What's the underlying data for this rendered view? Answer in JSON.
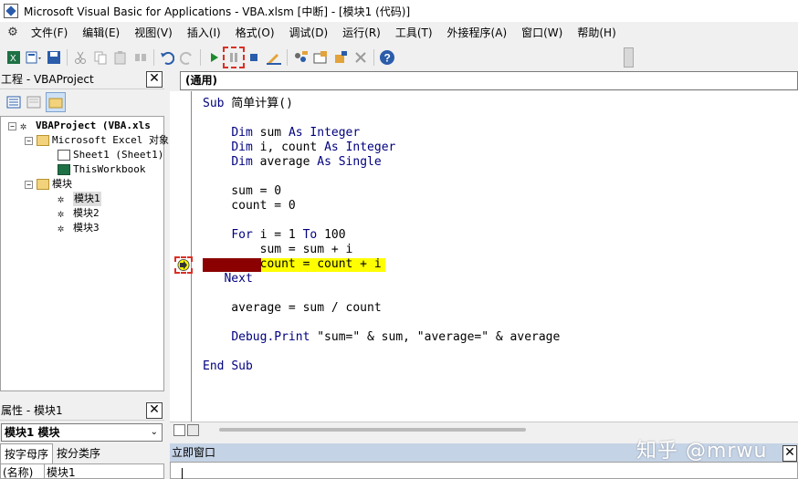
{
  "window": {
    "title": "Microsoft Visual Basic for Applications - VBA.xlsm [中断] - [模块1 (代码)]"
  },
  "menu": [
    "文件(F)",
    "编辑(E)",
    "视图(V)",
    "插入(I)",
    "格式(O)",
    "调试(D)",
    "运行(R)",
    "工具(T)",
    "外接程序(A)",
    "窗口(W)",
    "帮助(H)"
  ],
  "toolbar": {
    "icons": [
      "excel-icon",
      "insert-module-icon",
      "save-icon",
      "cut-icon",
      "copy-icon",
      "paste-icon",
      "find-icon",
      "undo-icon",
      "redo-icon",
      "run-icon",
      "break-icon",
      "reset-icon",
      "design-mode-icon",
      "project-explorer-icon",
      "properties-icon",
      "object-browser-icon",
      "toolbox-icon",
      "help-icon"
    ]
  },
  "project": {
    "title": "工程 - VBAProject",
    "close": "✕",
    "tree": {
      "root": "VBAProject (VBA.xls",
      "excel_folder": "Microsoft Excel 对象",
      "sheet1": "Sheet1 (Sheet1)",
      "workbook": "ThisWorkbook",
      "modules_folder": "模块",
      "modules": [
        "模块1",
        "模块2",
        "模块3"
      ]
    }
  },
  "properties": {
    "title": "属性 - 模块1",
    "close": "✕",
    "combo": "模块1 模块",
    "tab_alpha": "按字母序",
    "tab_cat": "按分类序",
    "row_name": "(名称)",
    "row_value": "模块1"
  },
  "code": {
    "object_combo": "(通用)",
    "lines": [
      {
        "text": "Sub 简单计算()"
      },
      {
        "text": ""
      },
      {
        "text": "    Dim sum As Integer"
      },
      {
        "text": "    Dim i, count As Integer"
      },
      {
        "text": "    Dim average As Single"
      },
      {
        "text": ""
      },
      {
        "text": "    sum = 0"
      },
      {
        "text": "    count = 0"
      },
      {
        "text": ""
      },
      {
        "text": "    For i = 1 To 100"
      },
      {
        "text": "        sum = sum + i"
      },
      {
        "text": "        count = count + i"
      },
      {
        "text": "   Next"
      },
      {
        "text": ""
      },
      {
        "text": "    average = sum / count"
      },
      {
        "text": ""
      },
      {
        "text": "    Debug.Print \"sum=\" & sum, \"average=\" & average"
      },
      {
        "text": ""
      },
      {
        "text": "End Sub"
      }
    ]
  },
  "immediate": {
    "title": "立即窗口",
    "close": "✕"
  },
  "watermark": "知乎 @mrwu",
  "colors": {
    "keyword": "#00007f",
    "breakpoint": "#8b0000",
    "current_line": "#ffff00",
    "annotation": "#d93025"
  }
}
